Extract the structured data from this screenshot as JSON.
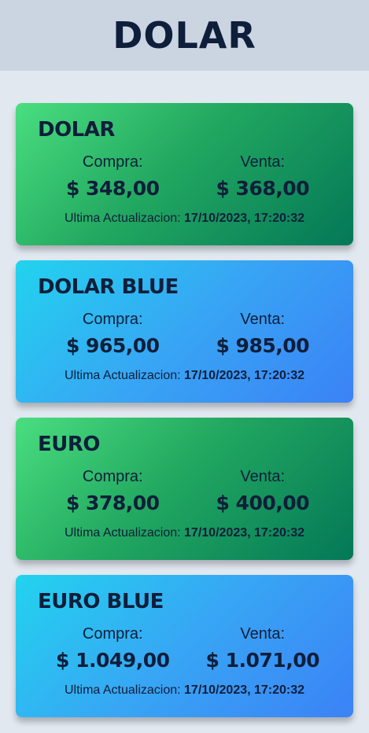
{
  "header": {
    "title": "DOLAR"
  },
  "cards": [
    {
      "title": "DOLAR",
      "buy_label": "Compra:",
      "buy_value": "$ 348,00",
      "sell_label": "Venta:",
      "sell_value": "$ 368,00",
      "updated_label": "Ultima Actualizacion:",
      "updated_value": "17/10/2023, 17:20:32"
    },
    {
      "title": "DOLAR BLUE",
      "buy_label": "Compra:",
      "buy_value": "$ 965,00",
      "sell_label": "Venta:",
      "sell_value": "$ 985,00",
      "updated_label": "Ultima Actualizacion:",
      "updated_value": "17/10/2023, 17:20:32"
    },
    {
      "title": "EURO",
      "buy_label": "Compra:",
      "buy_value": "$ 378,00",
      "sell_label": "Venta:",
      "sell_value": "$ 400,00",
      "updated_label": "Ultima Actualizacion:",
      "updated_value": "17/10/2023, 17:20:32"
    },
    {
      "title": "EURO BLUE",
      "buy_label": "Compra:",
      "buy_value": "$ 1.049,00",
      "sell_label": "Venta:",
      "sell_value": "$ 1.071,00",
      "updated_label": "Ultima Actualizacion:",
      "updated_value": "17/10/2023, 17:20:32"
    }
  ],
  "colors": {
    "background": "#e2e8f0",
    "header": "#cbd5e1",
    "text": "#0f1e3a",
    "green_start": "#4ade80",
    "green_end": "#047857",
    "blue_start": "#22d3ee",
    "blue_end": "#3b82f6"
  }
}
